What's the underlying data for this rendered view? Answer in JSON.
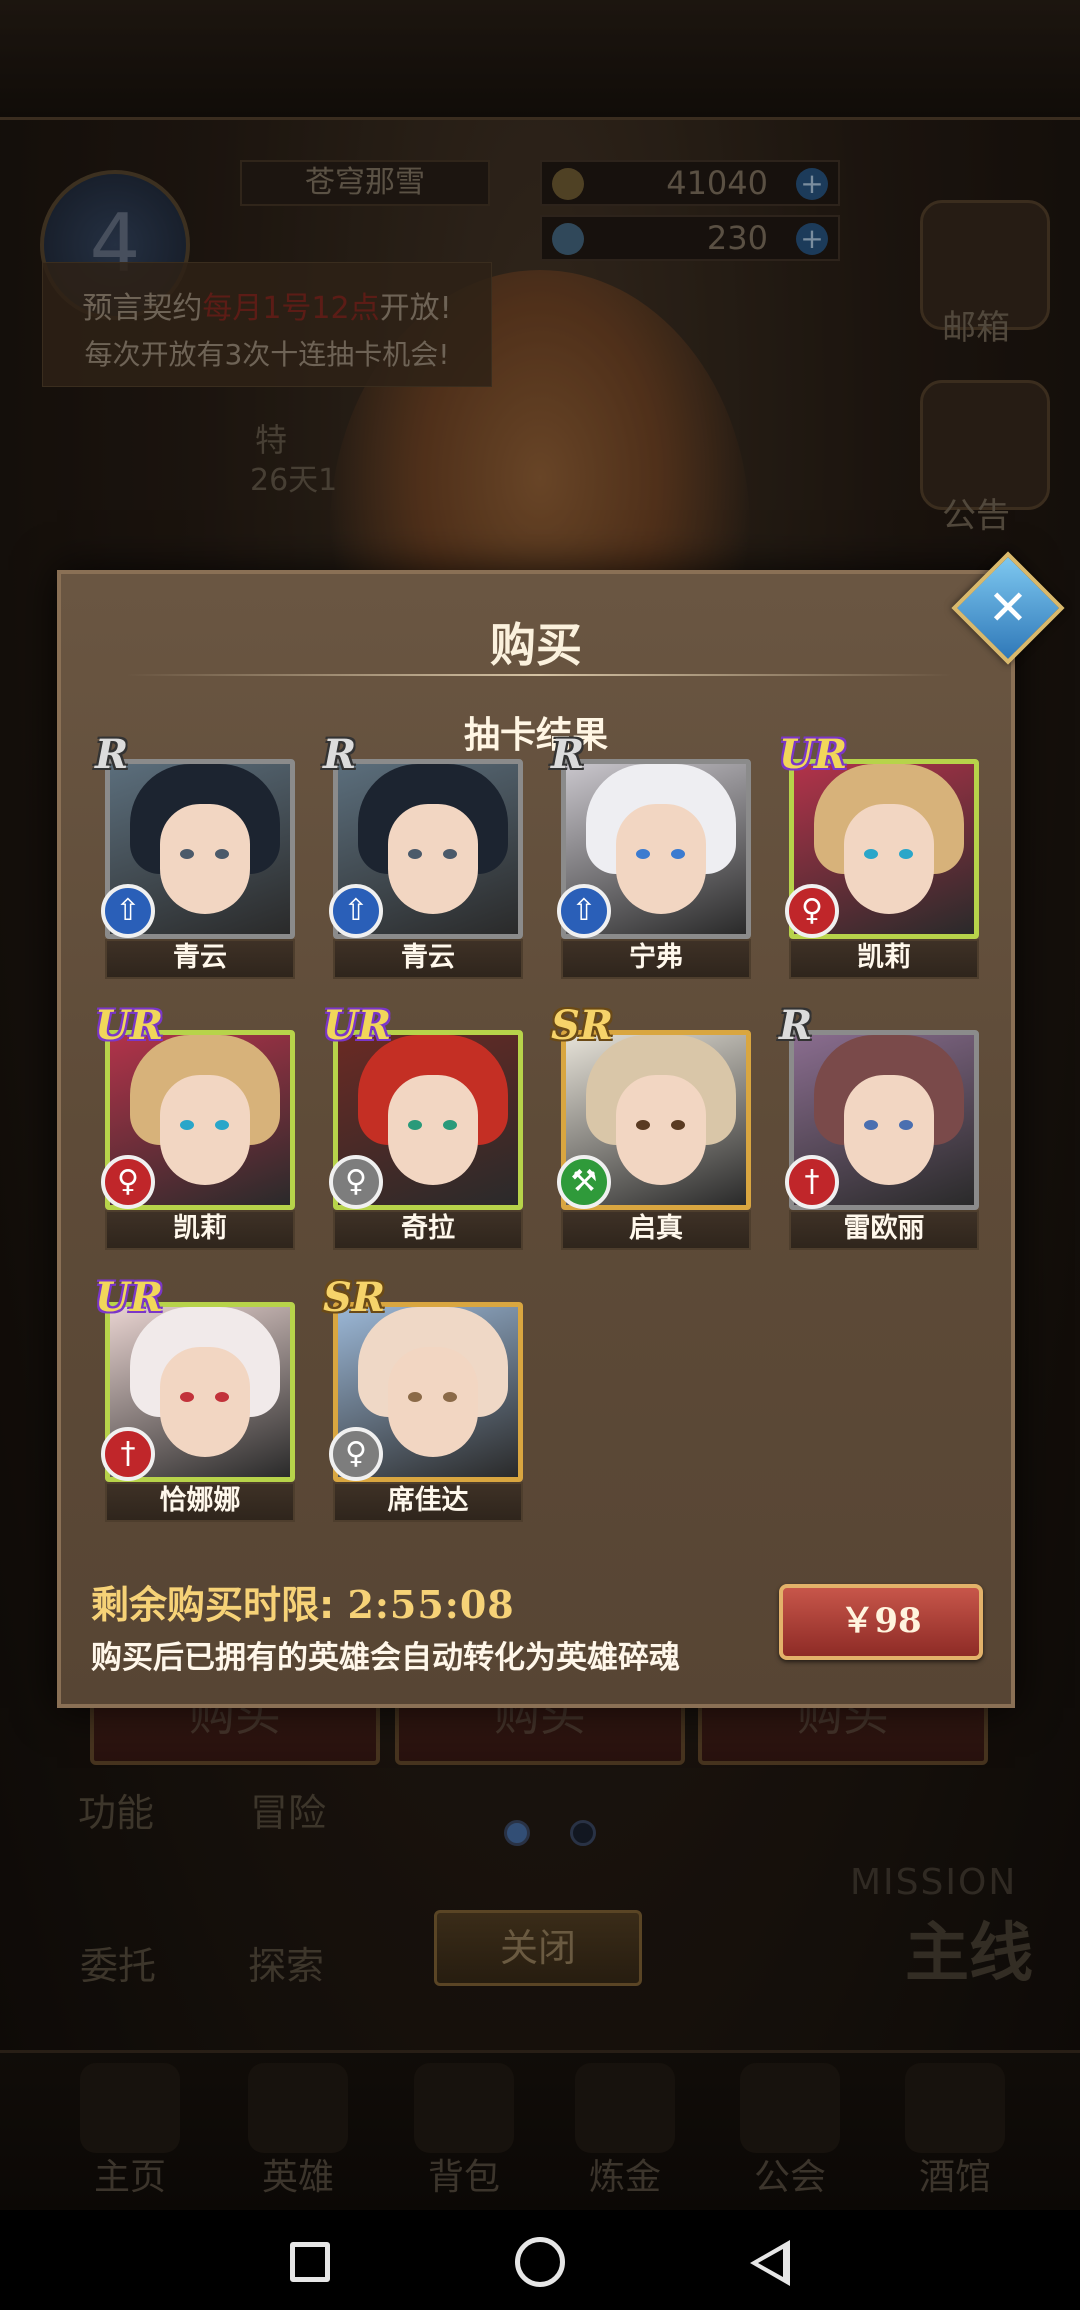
{
  "background": {
    "player_name": "苍穹那雪",
    "gold": "41040",
    "gems": "230",
    "level": "4",
    "notice_line1_pre": "预言契约",
    "notice_line1_red": "每月1号12点",
    "notice_line1_post": "开放!",
    "notice_line2": "每次开放有3次十连抽卡机会!",
    "special_label": "特",
    "timer_label": "26天1",
    "side_mailbox": "邮箱",
    "side_notice": "公告",
    "buy_buttons": [
      "购买",
      "购买",
      "购买"
    ],
    "sub_function": "功能",
    "sub_adventure": "冒险",
    "sub_commission": "委托",
    "sub_explore": "探索",
    "mission_en": "MISSION",
    "mission_cn": "主线",
    "close_label": "关闭",
    "nav": [
      "主页",
      "英雄",
      "背包",
      "炼金",
      "公会",
      "酒馆"
    ]
  },
  "modal": {
    "title": "购买",
    "subtitle": "抽卡结果",
    "remaining_label": "剩余购买时限:",
    "remaining_time": "2:55:08",
    "note": "购买后已拥有的英雄会自动转化为英雄碎魂",
    "price": "￥98",
    "close_icon": "x-icon"
  },
  "cards": [
    {
      "name": "青云",
      "rarity": "R",
      "class_color": "blue",
      "class_icon": "spear-icon"
    },
    {
      "name": "青云",
      "rarity": "R",
      "class_color": "blue",
      "class_icon": "spear-icon"
    },
    {
      "name": "宁弗",
      "rarity": "R",
      "class_color": "blue",
      "class_icon": "spear-icon"
    },
    {
      "name": "凯莉",
      "rarity": "UR",
      "class_color": "red",
      "class_icon": "staff-icon"
    },
    {
      "name": "凯莉",
      "rarity": "UR",
      "class_color": "red",
      "class_icon": "staff-icon"
    },
    {
      "name": "奇拉",
      "rarity": "UR",
      "class_color": "gray",
      "class_icon": "staff-icon"
    },
    {
      "name": "启真",
      "rarity": "SR",
      "class_color": "green",
      "class_icon": "axe-icon"
    },
    {
      "name": "雷欧丽",
      "rarity": "R",
      "class_color": "red",
      "class_icon": "sword-icon"
    },
    {
      "name": "恰娜娜",
      "rarity": "UR",
      "class_color": "red",
      "class_icon": "sword-icon"
    },
    {
      "name": "席佳达",
      "rarity": "SR",
      "class_color": "gray",
      "class_icon": "staff-icon"
    }
  ]
}
